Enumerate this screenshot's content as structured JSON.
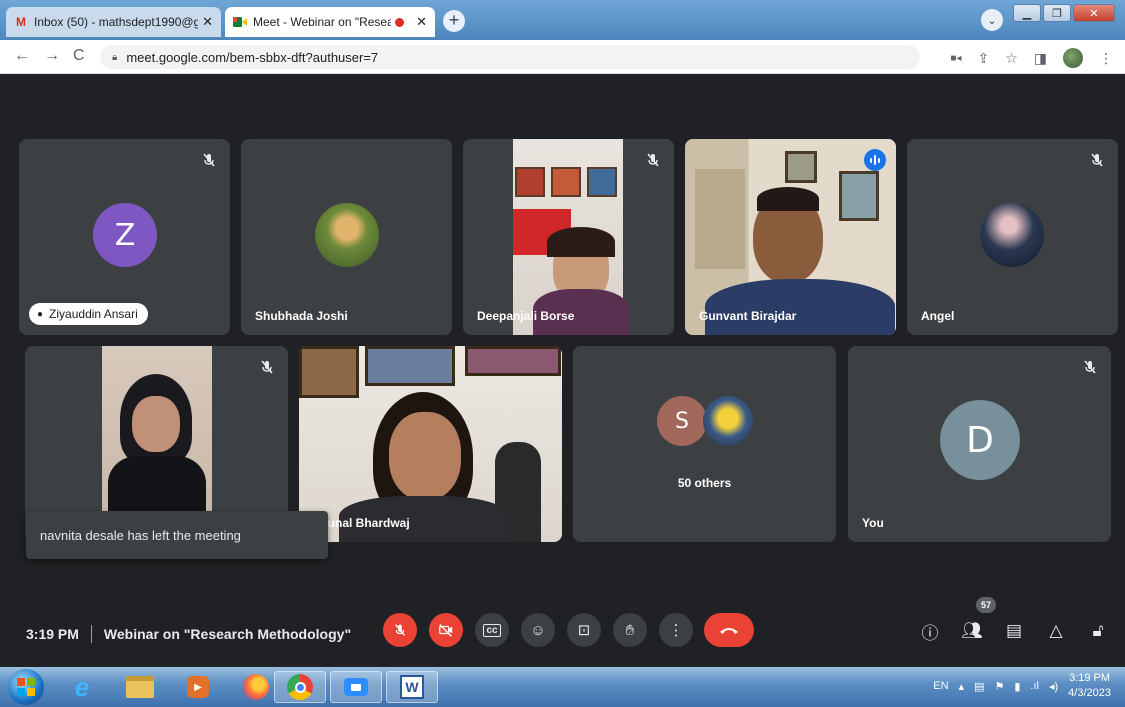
{
  "browser": {
    "tabs": [
      {
        "title": "Inbox (50) - mathsdept1990@gm",
        "favicon": "gmail-icon"
      },
      {
        "title": "Meet - Webinar on \"Researc",
        "favicon": "meet-icon",
        "active": true
      }
    ],
    "url": "meet.google.com/bem-sbbx-dft?authuser=7"
  },
  "participants_row1": [
    {
      "name": "Ziyauddin Ansari",
      "initial": "Z",
      "avatar_color": "#7e57c2"
    },
    {
      "name": "Shubhada Joshi"
    },
    {
      "name": "Deepanjali Borse"
    },
    {
      "name": "Gunvant Birajdar"
    },
    {
      "name": "Angel"
    }
  ],
  "participants_row2": [
    {
      "name": ""
    },
    {
      "name": "Mrunal Bhardwaj"
    },
    {
      "name": "50 others",
      "initial": "S",
      "avatar_color": "#a1675a"
    },
    {
      "name": "You",
      "initial": "D",
      "avatar_color": "#78909c"
    }
  ],
  "toast": "navnita desale has left the meeting",
  "meeting": {
    "time": "3:19 PM",
    "title": "Webinar on \"Research Methodology\"",
    "participant_count": "57"
  },
  "taskbar": {
    "language": "EN",
    "time": "3:19 PM",
    "date": "4/3/2023"
  }
}
